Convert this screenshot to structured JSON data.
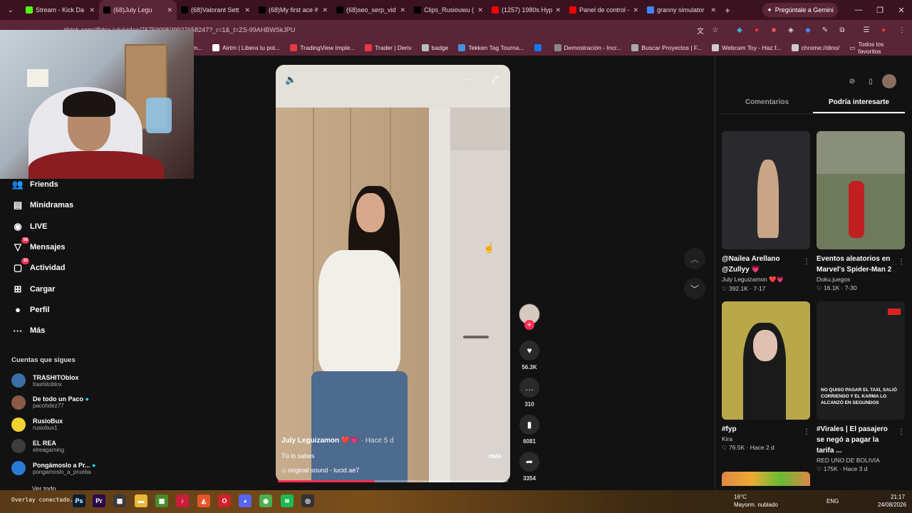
{
  "browser": {
    "tabs": [
      {
        "title": "Stream - Kick Da",
        "color": "#53fc18"
      },
      {
        "title": "(68)July Legu",
        "color": "#000000",
        "active": true
      },
      {
        "title": "(68)Valorant Sett",
        "color": "#000000"
      },
      {
        "title": "(68)My first ace #",
        "color": "#000000"
      },
      {
        "title": "(68)seo_serp_vid",
        "color": "#000000"
      },
      {
        "title": "Clips_Rusiouwu (",
        "color": "#000000"
      },
      {
        "title": "(1257) 1980s Hyp",
        "color": "#ff0000"
      },
      {
        "title": "Panel de control -",
        "color": "#ff0000"
      },
      {
        "title": "granny simulator",
        "color": "#4285f4"
      }
    ],
    "gemini_label": "Pregúntale a Gemini",
    "url": "tiktok.com/@itsx.july/video/7675909509927658247?_r=1&_t=ZS-99AHBWSkJPU",
    "bookmarks": [
      {
        "label": "giam...",
        "color": "#999999"
      },
      {
        "label": "Airtm | Libera tu pot...",
        "color": "#ffffff"
      },
      {
        "label": "TradingView Imple...",
        "color": "#e63946"
      },
      {
        "label": "Trader | Deriv",
        "color": "#e63946"
      },
      {
        "label": "badge",
        "color": "#bbbbbb"
      },
      {
        "label": "Tekken Tag Tourna...",
        "color": "#4a90d9"
      },
      {
        "label": "",
        "color": "#1877f2"
      },
      {
        "label": "Demostración - Incr...",
        "color": "#888888"
      },
      {
        "label": "Buscar Proyectos | F...",
        "color": "#aaaaaa"
      },
      {
        "label": "Webcam Toy - Haz f...",
        "color": "#cccccc"
      },
      {
        "label": "chrome://dino/",
        "color": "#cccccc"
      }
    ],
    "all_bookmarks": "Todos los favoritos"
  },
  "sidebar": {
    "items": [
      {
        "label": "Friends",
        "icon": "friends-icon",
        "glyph": "👥"
      },
      {
        "label": "Minidramas",
        "icon": "minidramas-icon",
        "glyph": "▤"
      },
      {
        "label": "LIVE",
        "icon": "live-icon",
        "glyph": "◉"
      },
      {
        "label": "Mensajes",
        "icon": "messages-icon",
        "glyph": "▽",
        "badge": "58"
      },
      {
        "label": "Actividad",
        "icon": "activity-icon",
        "glyph": "▢",
        "badge": "10"
      },
      {
        "label": "Cargar",
        "icon": "upload-icon",
        "glyph": "⊞"
      },
      {
        "label": "Perfil",
        "icon": "profile-icon",
        "glyph": "●"
      },
      {
        "label": "Más",
        "icon": "more-icon",
        "glyph": "···"
      }
    ],
    "following_title": "Cuentas que sigues",
    "accounts": [
      {
        "name": "TRASHITOblox",
        "handle": "trashitoblox",
        "color": "#3a6ea5"
      },
      {
        "name": "De todo un Paco",
        "handle": "pacohdez77",
        "color": "#8a5a44",
        "verified": true
      },
      {
        "name": "RusioBux",
        "handle": "rusiobux1",
        "color": "#f2d22e"
      },
      {
        "name": "EL REA",
        "handle": "elreagaming",
        "color": "#3d3d3d"
      },
      {
        "name": "Pongámoslo a Pr...",
        "handle": "pongamoslo_a_prueba",
        "color": "#2a7ad8",
        "verified": true
      }
    ],
    "see_all": "Ver todo"
  },
  "video": {
    "author": "July Leguizamon",
    "author_suffix": "❤️💗 · Hace 5 d",
    "description": "Tú lo sabes",
    "more": "más",
    "sound": "♫  original sound - lucid.ae7",
    "progress": 0.42,
    "likes": "56.3K",
    "comments": "310",
    "saves": "6081",
    "shares": "3354"
  },
  "right_panel": {
    "tabs": [
      "Comentarios",
      "Podría interesarte"
    ],
    "active_tab": 1,
    "cards": [
      {
        "title": "@Nailea Arellano @Zullyy 💗",
        "author": "July Leguizamon ❤️💗",
        "stats": "♡ 392.1K · 7-17",
        "bg": "#2a2a2e"
      },
      {
        "title": "Eventos aleatorios en Marvel's Spider-Man 2",
        "author": "Doku.juegos",
        "stats": "♡ 16.1K · 7-30",
        "bg": "#6f7a5c"
      },
      {
        "title": "#fyp",
        "author": "Kira",
        "stats": "♡ 76.5K · Hace 2 d",
        "bg": "#b8a84a"
      },
      {
        "title": "#Virales | El pasajero se negó a pagar la tarifa ...",
        "author": "RED UNO DE BOLIVIA",
        "stats": "♡ 175K · Hace 3 d",
        "bg": "#1e1e1e"
      }
    ],
    "news_overlay": "NO QUISO PAGAR EL TAXI, SALIÓ CORRIENDO Y EL KARMA LO ALCANZÓ EN SEGUNDOS"
  },
  "taskbar": {
    "overlay_status": "Overlay conectado.",
    "weather_temp": "16°C",
    "weather_desc": "Mayorm. nublado",
    "lang": "ENG",
    "time": "21:17",
    "date": "24/08/2026"
  }
}
